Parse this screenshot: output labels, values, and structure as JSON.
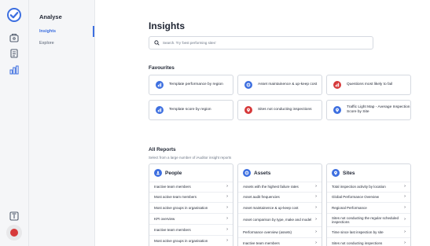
{
  "colors": {
    "accent": "#3d6fe0",
    "red": "#d6393a",
    "border": "#d5d9e0"
  },
  "subnav": {
    "title": "Analyse",
    "items": [
      {
        "label": "Insights",
        "active": true
      },
      {
        "label": "Explore",
        "active": false
      }
    ]
  },
  "main": {
    "title": "Insights",
    "search_placeholder": "Search. Try 'best performing sites'",
    "favourites_heading": "Favourites",
    "favourites": [
      {
        "label": "Template performance by region",
        "icon": "bar-chart-icon",
        "color": "#3d6fe0"
      },
      {
        "label": "Asset maintainence & up-keep cost",
        "icon": "asset-icon",
        "color": "#3d6fe0"
      },
      {
        "label": "Questions most likely to fail",
        "icon": "bar-chart-icon",
        "color": "#d6393a"
      },
      {
        "label": "Template score by region",
        "icon": "bar-chart-icon",
        "color": "#3d6fe0"
      },
      {
        "label": "Sites not conducting inspections",
        "icon": "location-pin-icon",
        "color": "#d6393a"
      },
      {
        "label": "Traffic Light Map - Average Inspection Score by Site",
        "icon": "location-pin-icon",
        "color": "#3d6fe0"
      }
    ],
    "all_reports_heading": "All Reports",
    "all_reports_sub": "Select from a large number of iAuditor insight reports",
    "columns": [
      {
        "title": "People",
        "icon": "person-icon",
        "rows": [
          "Inactive team members",
          "Most active team members",
          "Most active groups in organisation",
          "KPI overview",
          "Inactive team members",
          "Most active groups in organisation"
        ]
      },
      {
        "title": "Assets",
        "icon": "asset-icon",
        "rows": [
          "Assets with the highest failure rates",
          "Asset audit frequencies",
          "Asset maintainence & up-keep cost",
          "Asset comparison by type, make and model",
          "Performance overview (assets)",
          "Inactive team members"
        ]
      },
      {
        "title": "Sites",
        "icon": "location-pin-icon",
        "rows": [
          "Total inspection activity by location",
          "Global Performance Overview",
          "Regional Performance",
          "Sites not conducting the regular scheduled inspections",
          "Time since last inspection by site",
          "Sites not conducting inspections"
        ]
      }
    ]
  }
}
